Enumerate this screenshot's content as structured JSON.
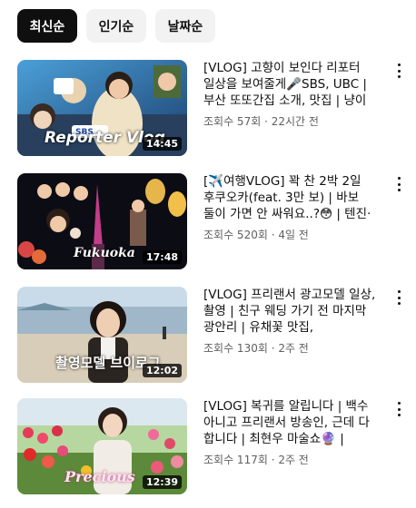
{
  "filters": [
    {
      "label": "최신순",
      "active": true
    },
    {
      "label": "인기순",
      "active": false
    },
    {
      "label": "날짜순",
      "active": false
    }
  ],
  "videos": [
    {
      "title": "[VLOG] 고향이 보인다 리포터 일상을 보여줄게🎤SBS, UBC | 부산 또또간집 소개, 맛집 | 냥이 도…",
      "meta": "조회수 57회 · 22시간 전",
      "duration": "14:45",
      "overlay": "Reporter Vlog",
      "logo": "SBS"
    },
    {
      "title": "[✈️여행VLOG] 꽉 찬 2박 2일 후쿠오카(feat. 3만 보) | 바보 둘이 가면 안 싸워요..?😳 | 텐진·하카…",
      "meta": "조회수 520회 · 4일 전",
      "duration": "17:48",
      "overlay": "Fukuoka"
    },
    {
      "title": "[VLOG] 프리랜서 광고모델 일상, 촬영 | 친구 웨딩 가기 전 마지막 광안리 | 유채꽃 맛집, 미나리삼겹살…",
      "meta": "조회수 130회 · 2주 전",
      "duration": "12:02",
      "overlay": "촬영모델 브이로그"
    },
    {
      "title": "[VLOG] 복귀를 알립니다 | 백수 아니고 프리랜서 방송인, 근데 다 합니다 | 최현우 마술쇼🔮 | 고전문구…",
      "meta": "조회수 117회 · 2주 전",
      "duration": "12:39",
      "overlay": "Precious"
    }
  ]
}
